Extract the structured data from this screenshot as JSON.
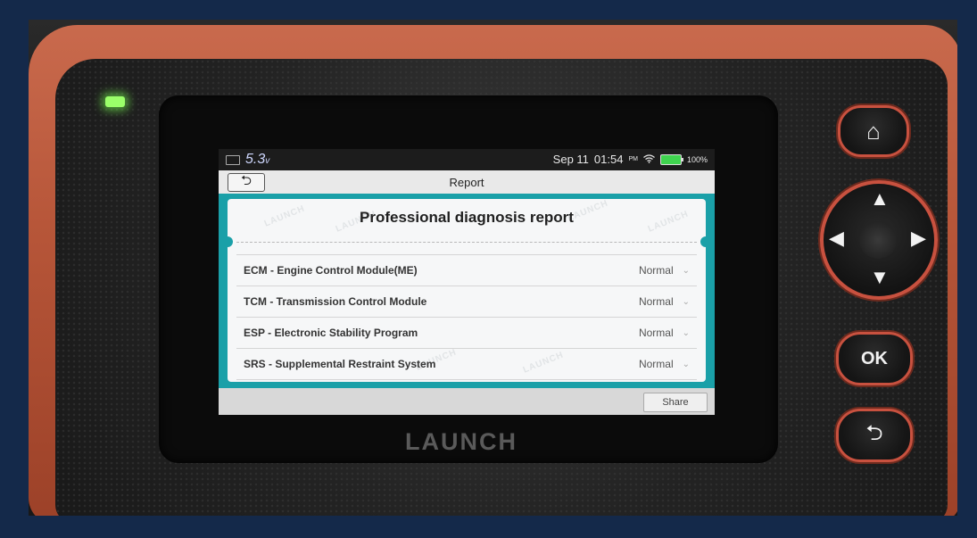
{
  "device": {
    "brand": "LAUNCH",
    "buttons": {
      "home_glyph": "⌂",
      "up_glyph": "▲",
      "down_glyph": "▼",
      "left_glyph": "◀",
      "right_glyph": "▶",
      "ok_label": "OK",
      "back_glyph": "⮌"
    }
  },
  "status_bar": {
    "voltage": "5.3",
    "voltage_unit": "v",
    "date": "Sep 11",
    "time": "01:54",
    "ampm": "PM",
    "battery": "100%"
  },
  "title_bar": {
    "back_glyph": "⮌",
    "title": "Report"
  },
  "report": {
    "heading": "Professional diagnosis report",
    "watermark": "LAUNCH",
    "modules": [
      {
        "name": "ECM - Engine Control Module(ME)",
        "status": "Normal"
      },
      {
        "name": "TCM - Transmission Control Module",
        "status": "Normal"
      },
      {
        "name": "ESP - Electronic Stability Program",
        "status": "Normal"
      },
      {
        "name": "SRS - Supplemental Restraint System",
        "status": "Normal"
      }
    ]
  },
  "bottom_bar": {
    "share_label": "Share"
  },
  "icons": {
    "wifi": "wifi-icon",
    "battery": "battery-icon",
    "chevron": "chevron-down-icon"
  },
  "colors": {
    "accent_teal": "#1aa0a8",
    "device_orange": "#b75639",
    "battery_green": "#3fd44f"
  }
}
